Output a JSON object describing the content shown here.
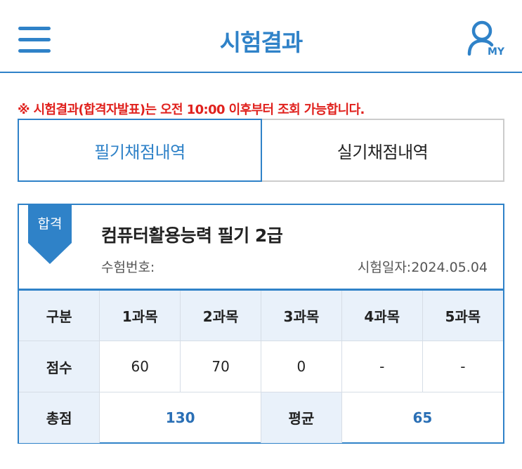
{
  "header": {
    "title": "시험결과",
    "my_label": "MY",
    "menu_icon": "hamburger-menu-icon",
    "user_icon": "user-icon"
  },
  "notice": {
    "mark": "※ ",
    "text": "시험결과(합격자발표)는 오전 10:00 이후부터 조회 가능합니다."
  },
  "tabs": [
    {
      "label": "필기채점내역",
      "active": true
    },
    {
      "label": "실기채점내역",
      "active": false
    }
  ],
  "result": {
    "badge": "합격",
    "certificate": "컴퓨터활용능력 필기 2급",
    "exam_number_label": "수험번호:",
    "exam_date_label": "시험일자:",
    "exam_date": "2024.05.04",
    "table": {
      "headers": [
        "구분",
        "1과목",
        "2과목",
        "3과목",
        "4과목",
        "5과목"
      ],
      "score_row_label": "점수",
      "scores": [
        "60",
        "70",
        "0",
        "-",
        "-"
      ],
      "total_label": "총점",
      "total": "130",
      "average_label": "평균",
      "average": "65"
    }
  },
  "colors": {
    "accent": "#2f82c8",
    "notice": "#e0211d",
    "header_cell": "#e9f1fa",
    "value_blue": "#2a6fb5"
  }
}
